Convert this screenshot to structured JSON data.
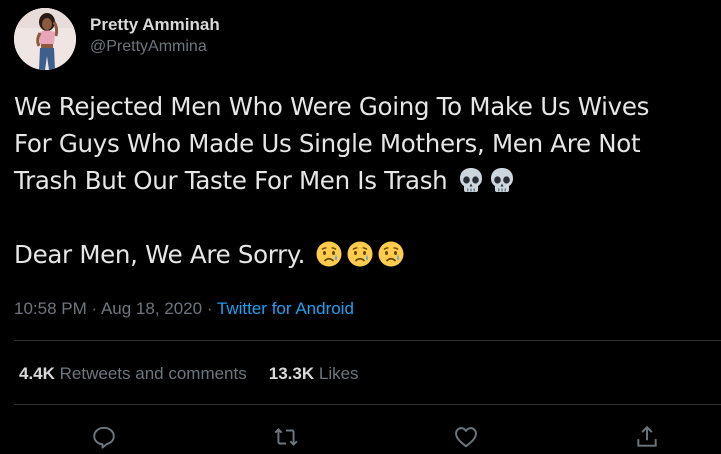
{
  "author": {
    "display_name": "Pretty Amminah",
    "handle": "@PrettyAmmina",
    "avatar_icon": "profile-photo-avatar"
  },
  "tweet": {
    "lines": [
      "We Rejected Men Who Were Going To Make Us Wives",
      "For Guys Who Made Us Single Mothers, Men Are Not",
      "Trash But Our Taste For Men Is Trash"
    ],
    "line3_emojis": [
      "skull-emoji",
      "skull-emoji"
    ],
    "second_paragraph": "Dear Men, We Are Sorry.",
    "para2_emojis": [
      "sad-tear-emoji",
      "sad-tear-emoji",
      "sad-tear-emoji"
    ]
  },
  "meta": {
    "time": "10:58 PM",
    "separator": " · ",
    "date": "Aug 18, 2020",
    "source": "Twitter for Android"
  },
  "stats": {
    "retweets_count": "4.4K",
    "retweets_label": "Retweets and comments",
    "likes_count": "13.3K",
    "likes_label": "Likes"
  },
  "actions": [
    "reply-icon",
    "retweet-icon",
    "like-icon",
    "share-icon"
  ],
  "colors": {
    "background": "#000000",
    "text": "#d9d9d9",
    "secondary": "#6e767d",
    "link": "#1da1f2",
    "divider": "#2f3336"
  }
}
